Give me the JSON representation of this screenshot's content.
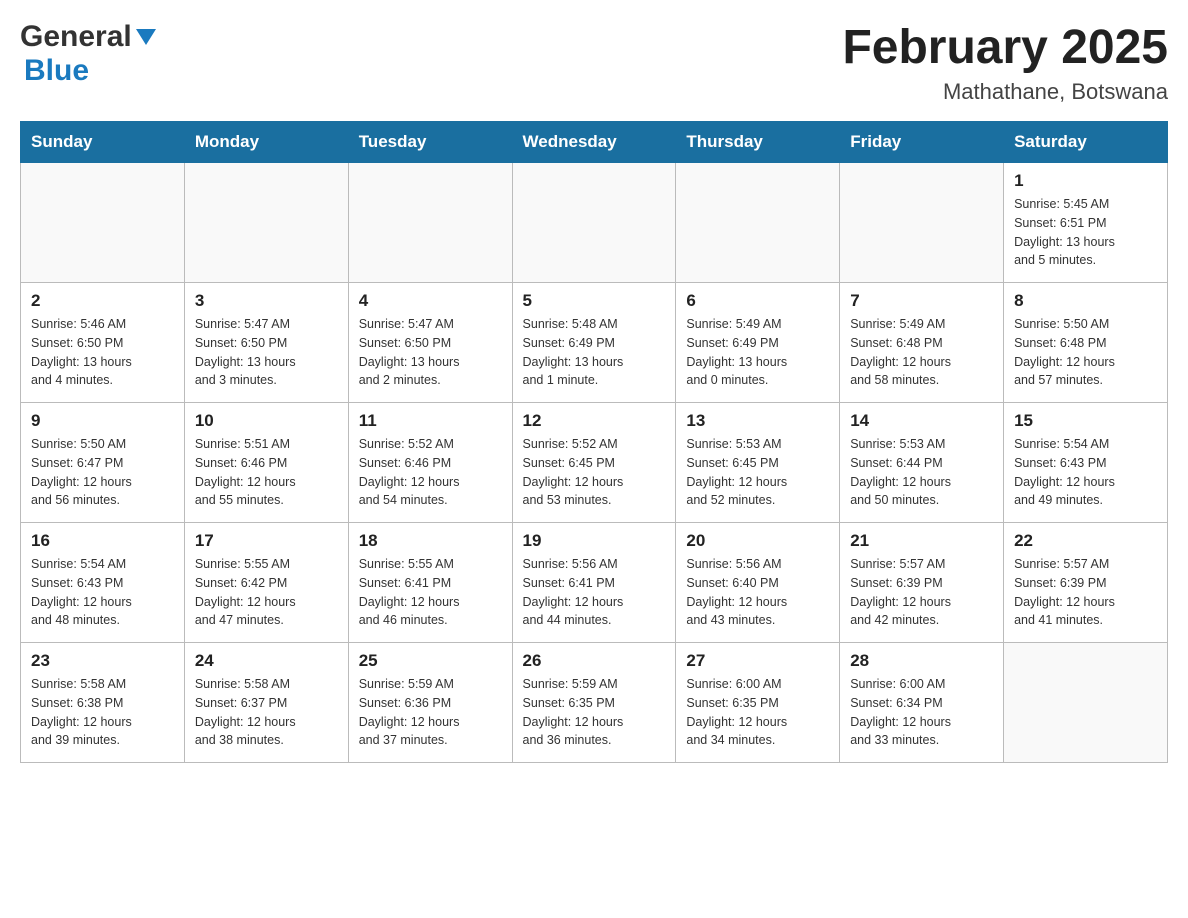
{
  "header": {
    "logo_general": "General",
    "logo_blue": "Blue",
    "month_title": "February 2025",
    "location": "Mathathane, Botswana"
  },
  "weekdays": [
    "Sunday",
    "Monday",
    "Tuesday",
    "Wednesday",
    "Thursday",
    "Friday",
    "Saturday"
  ],
  "weeks": [
    [
      {
        "day": "",
        "info": ""
      },
      {
        "day": "",
        "info": ""
      },
      {
        "day": "",
        "info": ""
      },
      {
        "day": "",
        "info": ""
      },
      {
        "day": "",
        "info": ""
      },
      {
        "day": "",
        "info": ""
      },
      {
        "day": "1",
        "info": "Sunrise: 5:45 AM\nSunset: 6:51 PM\nDaylight: 13 hours\nand 5 minutes."
      }
    ],
    [
      {
        "day": "2",
        "info": "Sunrise: 5:46 AM\nSunset: 6:50 PM\nDaylight: 13 hours\nand 4 minutes."
      },
      {
        "day": "3",
        "info": "Sunrise: 5:47 AM\nSunset: 6:50 PM\nDaylight: 13 hours\nand 3 minutes."
      },
      {
        "day": "4",
        "info": "Sunrise: 5:47 AM\nSunset: 6:50 PM\nDaylight: 13 hours\nand 2 minutes."
      },
      {
        "day": "5",
        "info": "Sunrise: 5:48 AM\nSunset: 6:49 PM\nDaylight: 13 hours\nand 1 minute."
      },
      {
        "day": "6",
        "info": "Sunrise: 5:49 AM\nSunset: 6:49 PM\nDaylight: 13 hours\nand 0 minutes."
      },
      {
        "day": "7",
        "info": "Sunrise: 5:49 AM\nSunset: 6:48 PM\nDaylight: 12 hours\nand 58 minutes."
      },
      {
        "day": "8",
        "info": "Sunrise: 5:50 AM\nSunset: 6:48 PM\nDaylight: 12 hours\nand 57 minutes."
      }
    ],
    [
      {
        "day": "9",
        "info": "Sunrise: 5:50 AM\nSunset: 6:47 PM\nDaylight: 12 hours\nand 56 minutes."
      },
      {
        "day": "10",
        "info": "Sunrise: 5:51 AM\nSunset: 6:46 PM\nDaylight: 12 hours\nand 55 minutes."
      },
      {
        "day": "11",
        "info": "Sunrise: 5:52 AM\nSunset: 6:46 PM\nDaylight: 12 hours\nand 54 minutes."
      },
      {
        "day": "12",
        "info": "Sunrise: 5:52 AM\nSunset: 6:45 PM\nDaylight: 12 hours\nand 53 minutes."
      },
      {
        "day": "13",
        "info": "Sunrise: 5:53 AM\nSunset: 6:45 PM\nDaylight: 12 hours\nand 52 minutes."
      },
      {
        "day": "14",
        "info": "Sunrise: 5:53 AM\nSunset: 6:44 PM\nDaylight: 12 hours\nand 50 minutes."
      },
      {
        "day": "15",
        "info": "Sunrise: 5:54 AM\nSunset: 6:43 PM\nDaylight: 12 hours\nand 49 minutes."
      }
    ],
    [
      {
        "day": "16",
        "info": "Sunrise: 5:54 AM\nSunset: 6:43 PM\nDaylight: 12 hours\nand 48 minutes."
      },
      {
        "day": "17",
        "info": "Sunrise: 5:55 AM\nSunset: 6:42 PM\nDaylight: 12 hours\nand 47 minutes."
      },
      {
        "day": "18",
        "info": "Sunrise: 5:55 AM\nSunset: 6:41 PM\nDaylight: 12 hours\nand 46 minutes."
      },
      {
        "day": "19",
        "info": "Sunrise: 5:56 AM\nSunset: 6:41 PM\nDaylight: 12 hours\nand 44 minutes."
      },
      {
        "day": "20",
        "info": "Sunrise: 5:56 AM\nSunset: 6:40 PM\nDaylight: 12 hours\nand 43 minutes."
      },
      {
        "day": "21",
        "info": "Sunrise: 5:57 AM\nSunset: 6:39 PM\nDaylight: 12 hours\nand 42 minutes."
      },
      {
        "day": "22",
        "info": "Sunrise: 5:57 AM\nSunset: 6:39 PM\nDaylight: 12 hours\nand 41 minutes."
      }
    ],
    [
      {
        "day": "23",
        "info": "Sunrise: 5:58 AM\nSunset: 6:38 PM\nDaylight: 12 hours\nand 39 minutes."
      },
      {
        "day": "24",
        "info": "Sunrise: 5:58 AM\nSunset: 6:37 PM\nDaylight: 12 hours\nand 38 minutes."
      },
      {
        "day": "25",
        "info": "Sunrise: 5:59 AM\nSunset: 6:36 PM\nDaylight: 12 hours\nand 37 minutes."
      },
      {
        "day": "26",
        "info": "Sunrise: 5:59 AM\nSunset: 6:35 PM\nDaylight: 12 hours\nand 36 minutes."
      },
      {
        "day": "27",
        "info": "Sunrise: 6:00 AM\nSunset: 6:35 PM\nDaylight: 12 hours\nand 34 minutes."
      },
      {
        "day": "28",
        "info": "Sunrise: 6:00 AM\nSunset: 6:34 PM\nDaylight: 12 hours\nand 33 minutes."
      },
      {
        "day": "",
        "info": ""
      }
    ]
  ]
}
